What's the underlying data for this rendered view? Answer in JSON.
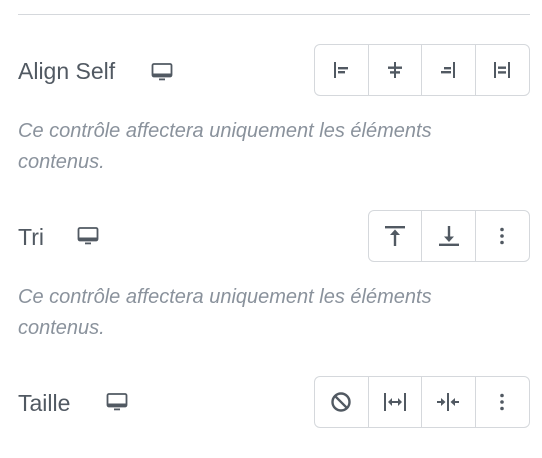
{
  "align_self": {
    "label": "Align Self",
    "device_icon": "desktop-icon",
    "buttons": [
      {
        "name": "align-start-icon"
      },
      {
        "name": "align-center-icon"
      },
      {
        "name": "align-end-icon"
      },
      {
        "name": "align-stretch-icon"
      }
    ]
  },
  "note_1": "Ce contrôle affectera uniquement les éléments contenus.",
  "order": {
    "label": "Tri",
    "device_icon": "desktop-icon",
    "buttons": [
      {
        "name": "order-first-icon"
      },
      {
        "name": "order-last-icon"
      },
      {
        "name": "more-options-icon"
      }
    ]
  },
  "note_2": "Ce contrôle affectera uniquement les éléments contenus.",
  "size": {
    "label": "Taille",
    "device_icon": "desktop-icon",
    "buttons": [
      {
        "name": "size-none-icon"
      },
      {
        "name": "size-grow-icon"
      },
      {
        "name": "size-shrink-icon"
      },
      {
        "name": "more-options-icon"
      }
    ]
  },
  "colors": {
    "text": "#515962",
    "note": "#8a929c",
    "border": "#d5d8dc",
    "icon": "#515962"
  }
}
